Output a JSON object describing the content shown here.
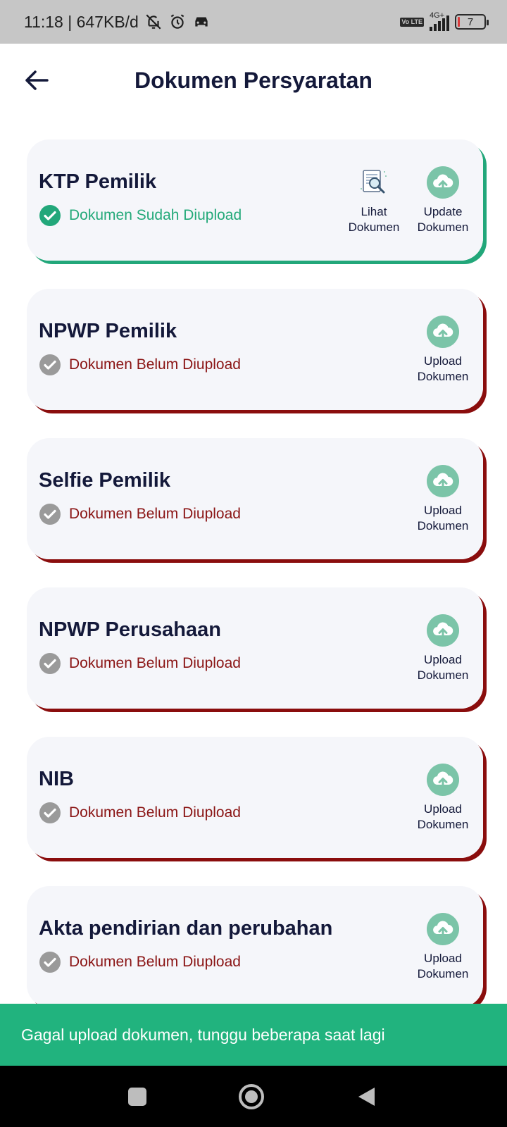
{
  "status_bar": {
    "time_speed": "11:18 | 647KB/d",
    "network": "4G+",
    "volte": "Vo LTE",
    "battery": "7"
  },
  "header": {
    "title": "Dokumen Persyaratan"
  },
  "documents": [
    {
      "title": "KTP Pemilik",
      "status": "Dokumen Sudah Diupload",
      "uploaded": true,
      "actions": [
        {
          "label": "Lihat\nDokumen",
          "icon": "view-document-icon"
        },
        {
          "label": "Update\nDokumen",
          "icon": "cloud-upload-icon"
        }
      ]
    },
    {
      "title": "NPWP Pemilik",
      "status": "Dokumen Belum Diupload",
      "uploaded": false,
      "actions": [
        {
          "label": "Upload\nDokumen",
          "icon": "cloud-upload-icon"
        }
      ]
    },
    {
      "title": "Selfie Pemilik",
      "status": "Dokumen Belum Diupload",
      "uploaded": false,
      "actions": [
        {
          "label": "Upload\nDokumen",
          "icon": "cloud-upload-icon"
        }
      ]
    },
    {
      "title": "NPWP Perusahaan",
      "status": "Dokumen Belum Diupload",
      "uploaded": false,
      "actions": [
        {
          "label": "Upload\nDokumen",
          "icon": "cloud-upload-icon"
        }
      ]
    },
    {
      "title": "NIB",
      "status": "Dokumen Belum Diupload",
      "uploaded": false,
      "actions": [
        {
          "label": "Upload\nDokumen",
          "icon": "cloud-upload-icon"
        }
      ]
    },
    {
      "title": "Akta pendirian dan perubahan",
      "status": "Dokumen Belum Diupload",
      "uploaded": false,
      "actions": [
        {
          "label": "Upload\nDokumen",
          "icon": "cloud-upload-icon"
        }
      ]
    }
  ],
  "toast": {
    "message": "Gagal upload dokumen, tunggu beberapa saat lagi"
  },
  "colors": {
    "accent_green": "#22a77a",
    "error_red": "#8a0d0d",
    "toast_green": "#21b37e",
    "upload_icon": "#7bc4a8",
    "title_navy": "#14193a"
  }
}
